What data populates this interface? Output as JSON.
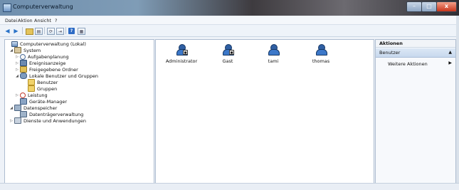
{
  "window": {
    "title": "Computerverwaltung"
  },
  "menu": [
    "Datei",
    "Aktion",
    "Ansicht",
    "?"
  ],
  "tree": {
    "root": "Computerverwaltung (Lokal)",
    "system": "System",
    "aufgaben": "Aufgabenplanung",
    "ereignis": "Ereignisanzeige",
    "freigegeben": "Freigegebene Ordner",
    "lokale": "Lokale Benutzer und Gruppen",
    "benutzer": "Benutzer",
    "gruppen": "Gruppen",
    "leistung": "Leistung",
    "geraete": "Geräte-Manager",
    "datenspeicher": "Datenspeicher",
    "datentraeger": "Datenträgerverwaltung",
    "dienste": "Dienste und Anwendungen"
  },
  "users": [
    "Administrator",
    "Gast",
    "tami",
    "thomas"
  ],
  "actions": {
    "header": "Aktionen",
    "section": "Benutzer",
    "item": "Weitere Aktionen"
  }
}
